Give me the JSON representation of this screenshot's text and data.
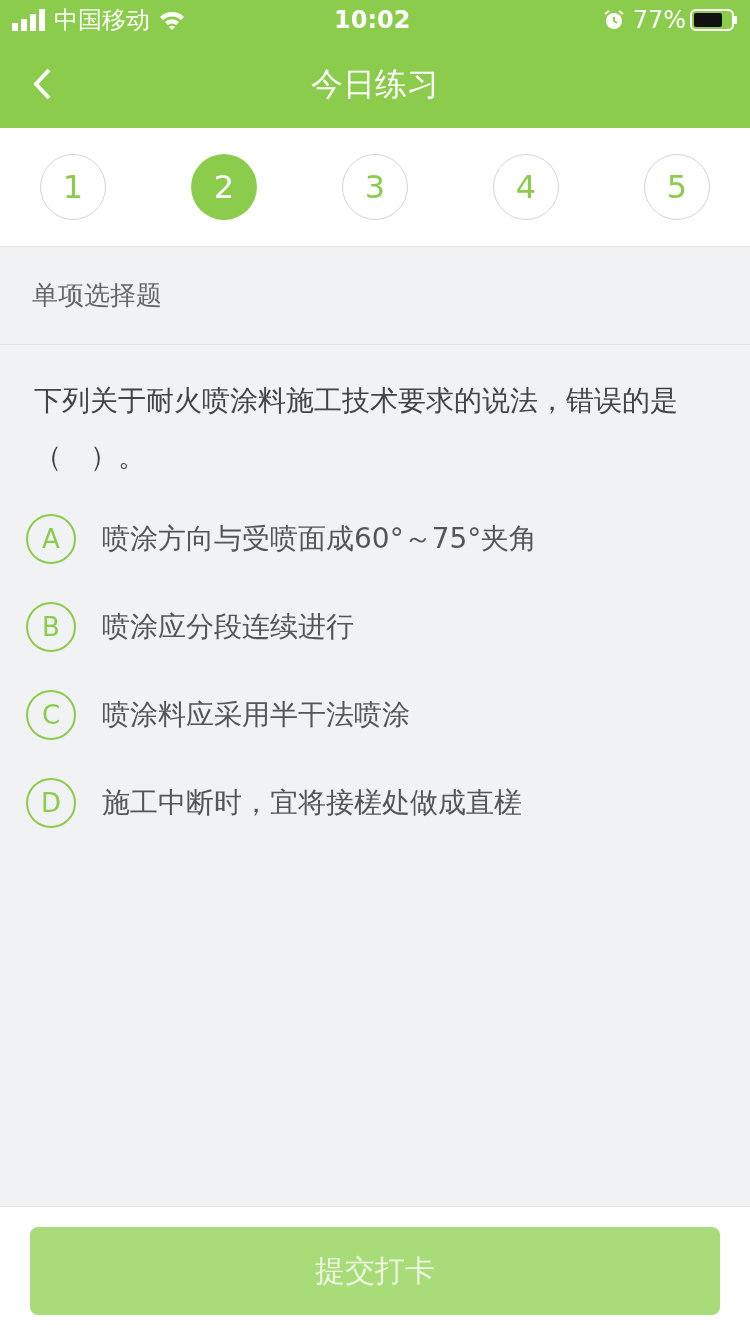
{
  "status_bar": {
    "carrier": "中国移动",
    "time": "10:02",
    "battery": "77%"
  },
  "header": {
    "title": "今日练习"
  },
  "steps": [
    {
      "label": "1",
      "selected": false
    },
    {
      "label": "2",
      "selected": true
    },
    {
      "label": "3",
      "selected": false
    },
    {
      "label": "4",
      "selected": false
    },
    {
      "label": "5",
      "selected": false
    }
  ],
  "section_label": "单项选择题",
  "question": "下列关于耐火喷涂料施工技术要求的说法，错误的是（　）。",
  "options": [
    {
      "letter": "A",
      "text": "喷涂方向与受喷面成60°～75°夹角",
      "selected": false
    },
    {
      "letter": "B",
      "text": "喷涂应分段连续进行",
      "selected": false
    },
    {
      "letter": "C",
      "text": "喷涂料应采用半干法喷涂",
      "selected": false
    },
    {
      "letter": "D",
      "text": "施工中断时，宜将接槎处做成直槎",
      "selected": false
    }
  ],
  "submit": {
    "label": "提交打卡",
    "disabled": true
  }
}
